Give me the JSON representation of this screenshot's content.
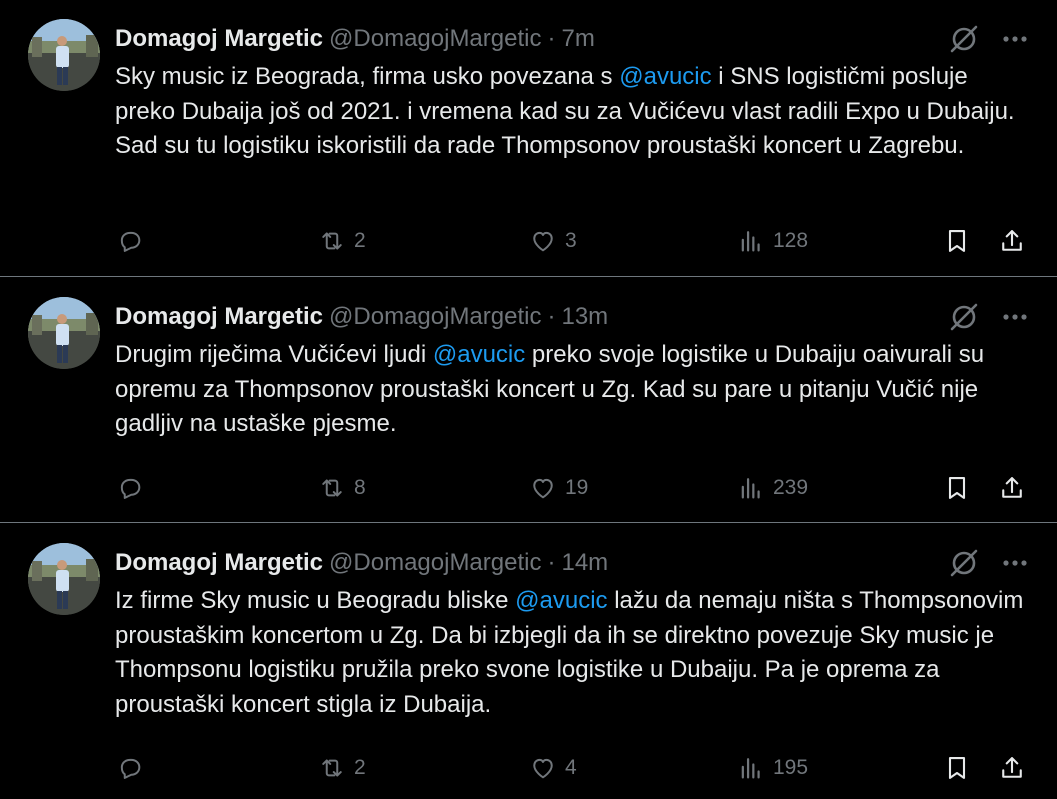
{
  "colors": {
    "background": "#000000",
    "text": "#e7e9ea",
    "secondary": "#71767b",
    "mention": "#1d9bf0",
    "divider": "#6e767d"
  },
  "tweets": [
    {
      "name": "Domagoj Margetic",
      "handle": "@DomagojMargetic",
      "separator": "·",
      "time": "7m",
      "text_before": "Sky music iz Beograda, firma usko povezana s ",
      "mention": "@avucic",
      "text_after": " i SNS logističmi posluje preko Dubaija još od 2021. i vremena kad su za Vučićevu vlast radili Expo u Dubaiju. Sad su tu logistiku iskoristili da rade Thompsonov proustaški koncert u Zagrebu.",
      "reposts": "2",
      "likes": "3",
      "views": "128"
    },
    {
      "name": "Domagoj Margetic",
      "handle": "@DomagojMargetic",
      "separator": "·",
      "time": "13m",
      "text_before": "Drugim riječima Vučićevi ljudi ",
      "mention": "@avucic",
      "text_after": " preko svoje logistike u Dubaiju oaivurali su opremu za Thompsonov proustaški koncert u Zg. Kad su pare u pitanju Vučić nije gadljiv na ustaške pjesme.",
      "reposts": "8",
      "likes": "19",
      "views": "239"
    },
    {
      "name": "Domagoj Margetic",
      "handle": "@DomagojMargetic",
      "separator": "·",
      "time": "14m",
      "text_before": "Iz firme Sky music u Beogradu bliske ",
      "mention": "@avucic",
      "text_after": " lažu da nemaju ništa s Thompsonovim proustaškim koncertom u Zg. Da bi izbjegli da ih se direktno povezuje Sky music je Thompsonu logistiku pružila preko svone logistike u Dubaiju. Pa je oprema za proustaški koncert stigla iz Dubaija.",
      "reposts": "2",
      "likes": "4",
      "views": "195"
    }
  ],
  "icons": {
    "grok": "grok-icon",
    "more": "more-icon",
    "reply": "reply-icon",
    "repost": "repost-icon",
    "like": "like-icon",
    "views": "views-icon",
    "bookmark": "bookmark-icon",
    "share": "share-icon"
  }
}
